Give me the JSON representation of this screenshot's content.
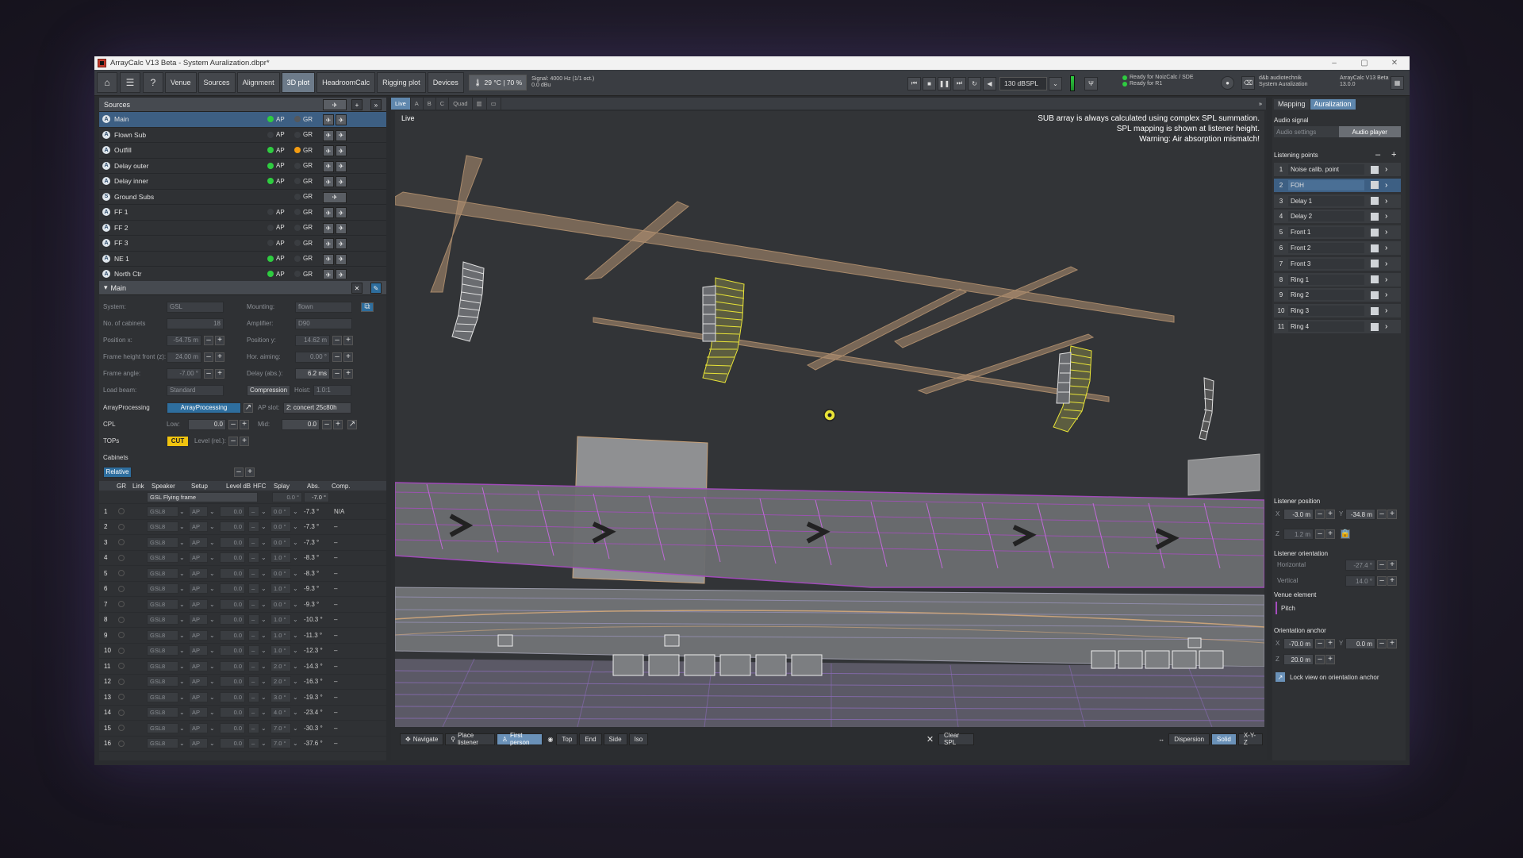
{
  "window": {
    "title": "ArrayCalc V13 Beta - System Auralization.dbpr*",
    "controls": [
      "–",
      "▢",
      "✕"
    ]
  },
  "toolbar": {
    "icons": [
      "home-icon",
      "menu-icon",
      "help-icon"
    ],
    "tabs": [
      "Venue",
      "Sources",
      "Alignment",
      "3D plot",
      "HeadroomCalc",
      "Rigging plot",
      "Devices"
    ],
    "active_tab": "3D plot",
    "environment": "29 °C | 70 %",
    "signal_line1": "Signal: 4000 Hz (1/1 oct.)",
    "signal_line2": "0.0 dBu",
    "level": "130 dBSPL",
    "status1": "Ready for NoizCalc / SDE",
    "status2": "Ready for R1",
    "brand1": "d&b audiotechnik",
    "brand2": "System Auralization",
    "version1": "ArrayCalc V13 Beta",
    "version2": "13.0.0"
  },
  "sources": {
    "header": "Sources",
    "items": [
      {
        "letter": "A",
        "name": "Main",
        "ap": "AP",
        "gr": "GR",
        "ap_state": "green",
        "gr_state": "gray",
        "selected": true
      },
      {
        "letter": "A",
        "name": "Flown Sub",
        "ap": "AP",
        "gr": "GR",
        "ap_state": "off",
        "gr_state": "off"
      },
      {
        "letter": "A",
        "name": "Outfill",
        "ap": "AP",
        "gr": "GR",
        "ap_state": "green",
        "gr_state": "orange"
      },
      {
        "letter": "A",
        "name": "Delay outer",
        "ap": "AP",
        "gr": "GR",
        "ap_state": "green",
        "gr_state": "off"
      },
      {
        "letter": "A",
        "name": "Delay inner",
        "ap": "AP",
        "gr": "GR",
        "ap_state": "green",
        "gr_state": "off"
      },
      {
        "letter": "S",
        "name": "Ground Subs",
        "ap": "",
        "gr": "GR",
        "ap_state": "none",
        "gr_state": "off"
      },
      {
        "letter": "A",
        "name": "FF 1",
        "ap": "AP",
        "gr": "GR",
        "ap_state": "off",
        "gr_state": "off"
      },
      {
        "letter": "A",
        "name": "FF 2",
        "ap": "AP",
        "gr": "GR",
        "ap_state": "off",
        "gr_state": "off"
      },
      {
        "letter": "A",
        "name": "FF 3",
        "ap": "AP",
        "gr": "GR",
        "ap_state": "off",
        "gr_state": "off"
      },
      {
        "letter": "A",
        "name": "NE 1",
        "ap": "AP",
        "gr": "GR",
        "ap_state": "green",
        "gr_state": "off"
      },
      {
        "letter": "A",
        "name": "North Ctr",
        "ap": "AP",
        "gr": "GR",
        "ap_state": "green",
        "gr_state": "off"
      }
    ]
  },
  "main_panel": {
    "header": "Main",
    "system_label": "System:",
    "system_value": "GSL",
    "mounting_label": "Mounting:",
    "mounting_value": "flown",
    "cabinets_label": "No. of cabinets",
    "cabinets_value": "18",
    "amplifier_label": "Amplifier:",
    "amplifier_value": "D90",
    "posx_label": "Position x:",
    "posx_value": "-54.75 m",
    "posy_label": "Position y:",
    "posy_value": "14.62 m",
    "height_label": "Frame height front (z):",
    "height_value": "24.00 m",
    "hor_label": "Hor. aiming:",
    "hor_value": "0.00 °",
    "angle_label": "Frame angle:",
    "angle_value": "-7.00 °",
    "delay_label": "Delay (abs.):",
    "delay_value": "6.2 ms",
    "loadbeam_label": "Load beam:",
    "loadbeam_value": "Standard",
    "compression_label": "Compression",
    "hoist_label": "Hoist:",
    "hoist_value": "1.0:1",
    "ap_label": "ArrayProcessing",
    "ap_button": "ArrayProcessing",
    "apslot_label": "AP slot:",
    "apslot_value": "2: concert 25c80h",
    "cpl_label": "CPL",
    "low_label": "Low:",
    "low_value": "0.0",
    "mid_label": "Mid:",
    "mid_value": "0.0",
    "tops_label": "TOPs",
    "cut_label": "CUT",
    "level_label": "Level (rel.):",
    "cabinets_section": "Cabinets",
    "relative_button": "Relative"
  },
  "cabinets_table": {
    "headers": [
      "GR",
      "Link",
      "Speaker",
      "Setup",
      "Level dB",
      "HFC",
      "Splay",
      "Abs.",
      "Comp."
    ],
    "frame_row": {
      "speaker": "GSL Flying frame",
      "splay": "0.0 °",
      "abs": "-7.0 °"
    },
    "rows": [
      {
        "n": "1",
        "speaker": "GSL8",
        "setup": "AP",
        "level": "0.0",
        "hfc": "–",
        "splay": "0.0 °",
        "abs": "-7.3 °",
        "comp": "N/A"
      },
      {
        "n": "2",
        "speaker": "GSL8",
        "setup": "AP",
        "level": "0.0",
        "hfc": "–",
        "splay": "0.0 °",
        "abs": "-7.3 °",
        "comp": "–"
      },
      {
        "n": "3",
        "speaker": "GSL8",
        "setup": "AP",
        "level": "0.0",
        "hfc": "–",
        "splay": "0.0 °",
        "abs": "-7.3 °",
        "comp": "–"
      },
      {
        "n": "4",
        "speaker": "GSL8",
        "setup": "AP",
        "level": "0.0",
        "hfc": "–",
        "splay": "1.0 °",
        "abs": "-8.3 °",
        "comp": "–"
      },
      {
        "n": "5",
        "speaker": "GSL8",
        "setup": "AP",
        "level": "0.0",
        "hfc": "–",
        "splay": "0.0 °",
        "abs": "-8.3 °",
        "comp": "–"
      },
      {
        "n": "6",
        "speaker": "GSL8",
        "setup": "AP",
        "level": "0.0",
        "hfc": "–",
        "splay": "1.0 °",
        "abs": "-9.3 °",
        "comp": "–"
      },
      {
        "n": "7",
        "speaker": "GSL8",
        "setup": "AP",
        "level": "0.0",
        "hfc": "–",
        "splay": "0.0 °",
        "abs": "-9.3 °",
        "comp": "–"
      },
      {
        "n": "8",
        "speaker": "GSL8",
        "setup": "AP",
        "level": "0.0",
        "hfc": "–",
        "splay": "1.0 °",
        "abs": "-10.3 °",
        "comp": "–"
      },
      {
        "n": "9",
        "speaker": "GSL8",
        "setup": "AP",
        "level": "0.0",
        "hfc": "–",
        "splay": "1.0 °",
        "abs": "-11.3 °",
        "comp": "–"
      },
      {
        "n": "10",
        "speaker": "GSL8",
        "setup": "AP",
        "level": "0.0",
        "hfc": "–",
        "splay": "1.0 °",
        "abs": "-12.3 °",
        "comp": "–"
      },
      {
        "n": "11",
        "speaker": "GSL8",
        "setup": "AP",
        "level": "0.0",
        "hfc": "–",
        "splay": "2.0 °",
        "abs": "-14.3 °",
        "comp": "–"
      },
      {
        "n": "12",
        "speaker": "GSL8",
        "setup": "AP",
        "level": "0.0",
        "hfc": "–",
        "splay": "2.0 °",
        "abs": "-16.3 °",
        "comp": "–"
      },
      {
        "n": "13",
        "speaker": "GSL8",
        "setup": "AP",
        "level": "0.0",
        "hfc": "–",
        "splay": "3.0 °",
        "abs": "-19.3 °",
        "comp": "–"
      },
      {
        "n": "14",
        "speaker": "GSL8",
        "setup": "AP",
        "level": "0.0",
        "hfc": "–",
        "splay": "4.0 °",
        "abs": "-23.4 °",
        "comp": "–"
      },
      {
        "n": "15",
        "speaker": "GSL8",
        "setup": "AP",
        "level": "0.0",
        "hfc": "–",
        "splay": "7.0 °",
        "abs": "-30.3 °",
        "comp": "–"
      },
      {
        "n": "16",
        "speaker": "GSL8",
        "setup": "AP",
        "level": "0.0",
        "hfc": "–",
        "splay": "7.0 °",
        "abs": "-37.6 °",
        "comp": "–"
      }
    ]
  },
  "viewport": {
    "tabs": [
      "Live",
      "A",
      "B",
      "C",
      "Quad"
    ],
    "active_tab": "Live",
    "label": "Live",
    "warning1": "SUB array is always calculated using complex SPL summation.",
    "warning2": "SPL mapping is shown at listener height.",
    "warning3": "Warning: Air absorption mismatch!",
    "bottom": {
      "navigate": "Navigate",
      "place_listener": "Place listener",
      "first_person": "First person",
      "views": [
        "Top",
        "End",
        "Side",
        "Iso"
      ],
      "clear_spl": "Clear SPL",
      "dispersion": "Dispersion",
      "solid": "Solid",
      "xyz": "X-Y-Z"
    }
  },
  "right_panel": {
    "tabs": [
      "Mapping",
      "Auralization"
    ],
    "active_tab": "Auralization",
    "audio_signal": "Audio signal",
    "audio_settings": "Audio settings",
    "audio_player": "Audio player",
    "listening_points": "Listening points",
    "points": [
      {
        "n": "1",
        "name": "Noise calib. point"
      },
      {
        "n": "2",
        "name": "FOH",
        "selected": true
      },
      {
        "n": "3",
        "name": "Delay 1"
      },
      {
        "n": "4",
        "name": "Delay 2"
      },
      {
        "n": "5",
        "name": "Front 1"
      },
      {
        "n": "6",
        "name": "Front 2"
      },
      {
        "n": "7",
        "name": "Front 3"
      },
      {
        "n": "8",
        "name": "Ring 1"
      },
      {
        "n": "9",
        "name": "Ring 2"
      },
      {
        "n": "10",
        "name": "Ring 3"
      },
      {
        "n": "11",
        "name": "Ring 4"
      }
    ],
    "listener_position": "Listener position",
    "lp_x_label": "X",
    "lp_x": "-3.0 m",
    "lp_y_label": "Y",
    "lp_y": "-34.8 m",
    "lp_z_label": "Z",
    "lp_z": "1.2 m",
    "listener_orientation": "Listener orientation",
    "horizontal_label": "Horizontal",
    "horizontal": "-27.4 °",
    "vertical_label": "Vertical",
    "vertical": "14.0 °",
    "venue_element": "Venue element",
    "venue_element_value": "Pitch",
    "orientation_anchor": "Orientation anchor",
    "oa_x_label": "X",
    "oa_x": "-70.0 m",
    "oa_y_label": "Y",
    "oa_y": "0.0 m",
    "oa_z_label": "Z",
    "oa_z": "20.0 m",
    "lock_label": "Lock view on orientation anchor"
  },
  "colors": {
    "accent": "#3d5f83",
    "active_tab": "#6d7b8a",
    "selected_speaker": "#e8e337",
    "venue_seats": "#a64dbf",
    "truss": "#c8a27a",
    "cut_badge": "#f1c40f",
    "ap_button": "#2e6e9e"
  }
}
